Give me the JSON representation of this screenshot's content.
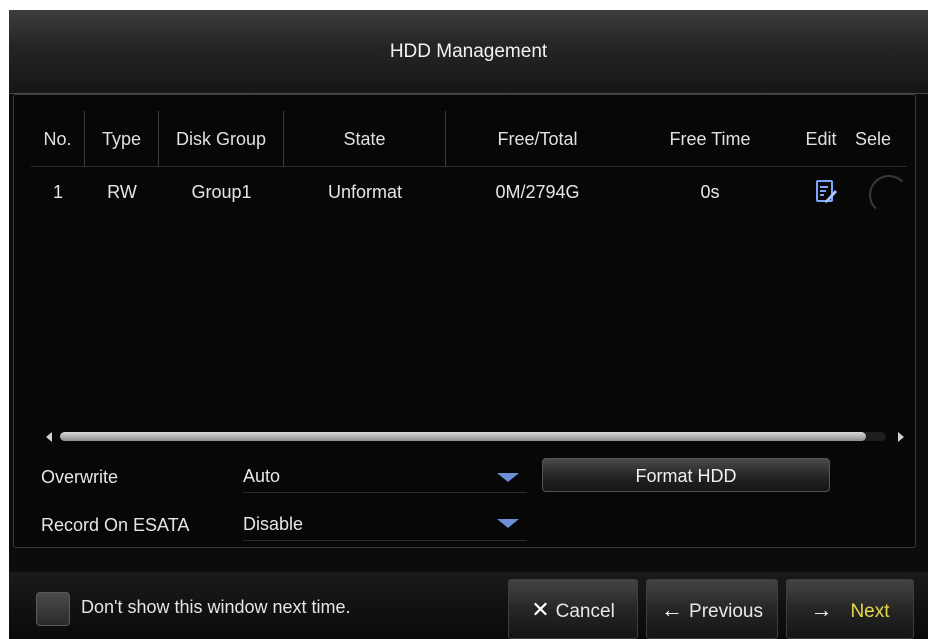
{
  "window": {
    "title": "HDD Management"
  },
  "table": {
    "headers": [
      "No.",
      "Type",
      "Disk Group",
      "State",
      "Free/Total",
      "Free Time",
      "Edit",
      "Sele"
    ],
    "rows": [
      {
        "no": "1",
        "type": "RW",
        "disk_group": "Group1",
        "state": "Unformat",
        "free_total": "0M/2794G",
        "free_time": "0s"
      }
    ]
  },
  "settings": {
    "overwrite": {
      "label": "Overwrite",
      "value": "Auto"
    },
    "record_on_esata": {
      "label": "Record On ESATA",
      "value": "Disable"
    },
    "format_button": "Format HDD"
  },
  "footer": {
    "dont_show_label": "Don't show this window next time.",
    "cancel": {
      "icon": "✕",
      "label": "Cancel"
    },
    "previous": {
      "icon": "←",
      "label": "Previous"
    },
    "next": {
      "icon": "→",
      "label": "Next"
    }
  },
  "colors": {
    "accent_blue": "#6d8fd8",
    "next_yellow": "#e8d94a",
    "background": "#0c0c0c"
  }
}
